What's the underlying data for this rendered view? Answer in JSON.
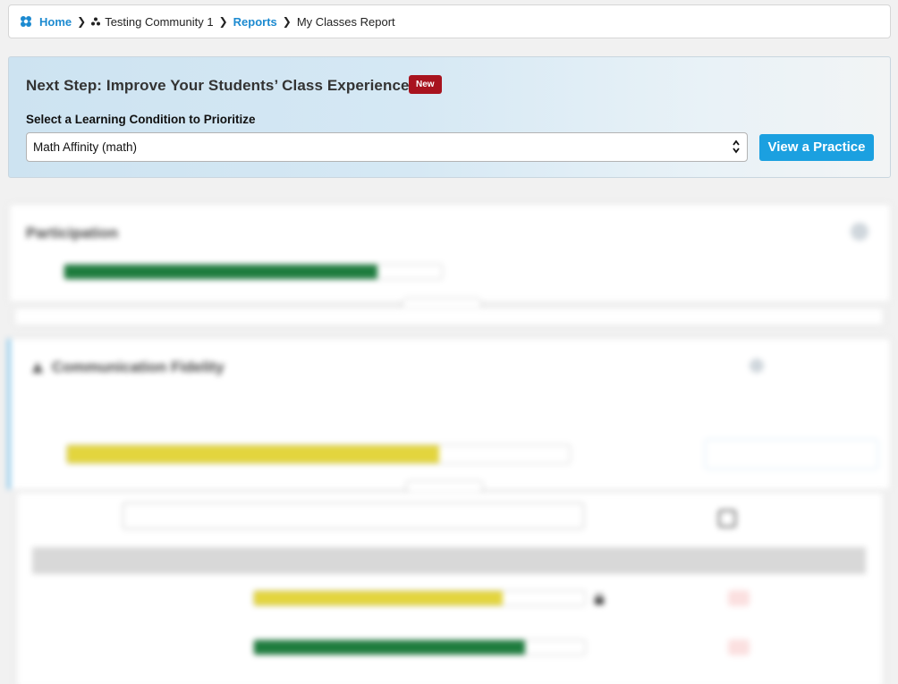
{
  "breadcrumb": {
    "home": "Home",
    "community": "Testing Community 1",
    "reports": "Reports",
    "current": "My Classes Report"
  },
  "next_step": {
    "title": "Next Step: Improve Your Students’ Class Experience",
    "badge": "New",
    "select_label": "Select a Learning Condition to Prioritize",
    "selected_condition": "Math Affinity (math)",
    "button": "View a Practice"
  },
  "participation": {
    "title": "Participation",
    "percent": "",
    "bar_fraction": 0.83,
    "message_bold": "",
    "message": "",
    "show_details": ""
  },
  "fidelity": {
    "title": "Communication Fidelity",
    "why_link": "",
    "description": "",
    "percent": "",
    "bar_fraction": 0.74,
    "change_note": "",
    "improve_button": "",
    "show_details": "",
    "filter_label": "",
    "filter_checkbox_label": "",
    "table_headers": [
      "",
      "",
      ""
    ],
    "rows": [
      {
        "class_name": "",
        "percent": "",
        "bar_fraction": 0.75,
        "bar_color": "#e3d53e",
        "locked": true
      },
      {
        "class_name": "",
        "percent": "",
        "bar_fraction": 0.82,
        "bar_color": "#1e7c3e",
        "locked": false
      }
    ]
  },
  "colors": {
    "accent": "#1c8ad0",
    "button": "#1ba0e0",
    "badge": "#a8131e",
    "green": "#1e7c3e",
    "yellow": "#e3d53e"
  }
}
